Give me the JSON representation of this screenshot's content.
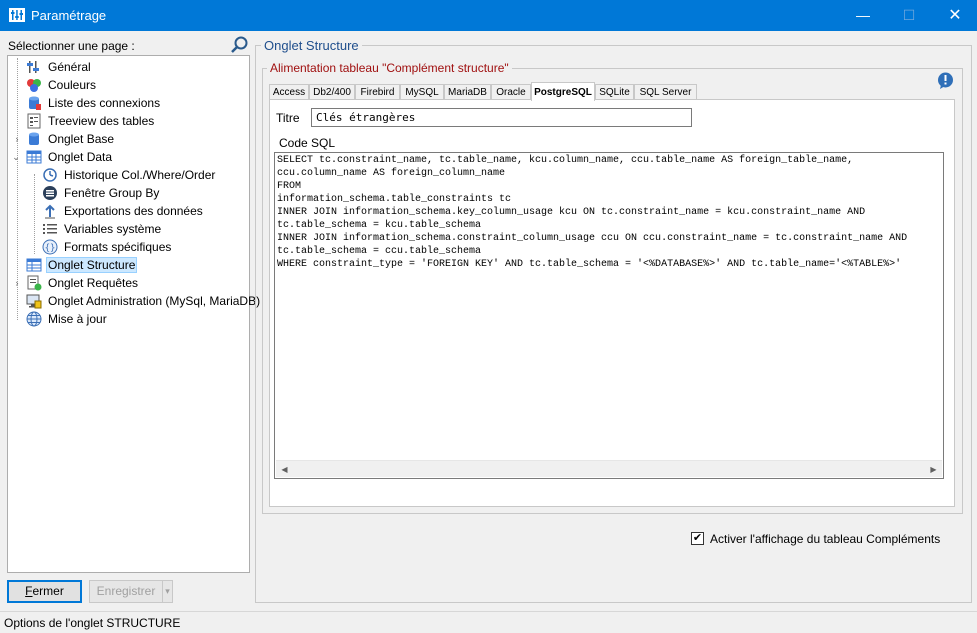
{
  "window": {
    "title": "Paramétrage",
    "min": "—",
    "max": "☐",
    "close": "✕"
  },
  "left": {
    "label": "Sélectionner une page :",
    "tree": [
      {
        "label": "Général"
      },
      {
        "label": "Couleurs"
      },
      {
        "label": "Liste des connexions"
      },
      {
        "label": "Treeview des tables"
      },
      {
        "label": "Onglet Base"
      },
      {
        "label": "Onglet Data"
      },
      {
        "label": "Historique Col./Where/Order"
      },
      {
        "label": "Fenêtre Group By"
      },
      {
        "label": "Exportations des données"
      },
      {
        "label": "Variables système"
      },
      {
        "label": "Formats spécifiques"
      },
      {
        "label": "Onglet Structure"
      },
      {
        "label": "Onglet Requêtes"
      },
      {
        "label": "Onglet Administration (MySql, MariaDB)"
      },
      {
        "label": "Mise à jour"
      }
    ],
    "buttons": {
      "close_first": "F",
      "close_rest": "ermer",
      "save": "Enregistrer",
      "save_dropdown": "▾"
    }
  },
  "right": {
    "group_title": "Onglet Structure",
    "subgroup_title": "Alimentation tableau \"Complément structure\"",
    "tabs": [
      "Access",
      "Db2/400",
      "Firebird",
      "MySQL",
      "MariaDB",
      "Oracle",
      "PostgreSQL",
      "SQLite",
      "SQL Server"
    ],
    "active_tab": "PostgreSQL",
    "titre_label": "Titre",
    "titre_value": "Clés étrangères",
    "code_label": "Code SQL",
    "code_sql": "SELECT tc.constraint_name, tc.table_name, kcu.column_name, ccu.table_name AS foreign_table_name,\nccu.column_name AS foreign_column_name\nFROM\ninformation_schema.table_constraints tc\nINNER JOIN information_schema.key_column_usage kcu ON tc.constraint_name = kcu.constraint_name AND\ntc.table_schema = kcu.table_schema\nINNER JOIN information_schema.constraint_column_usage ccu ON ccu.constraint_name = tc.constraint_name AND\ntc.table_schema = ccu.table_schema\nWHERE constraint_type = 'FOREIGN KEY' AND tc.table_schema = '<%DATABASE%>' AND tc.table_name='<%TABLE%>'",
    "checkbox_checked": true,
    "checkbox_mark": "✔",
    "checkbox_label": "Activer l'affichage du tableau Compléments"
  },
  "status": "Options de l'onglet STRUCTURE",
  "scroll": {
    "left": "◀",
    "right": "▶"
  },
  "colors": {
    "titlebar": "#0078d7",
    "selection": "#cce8ff",
    "group_title": "#1f4e8c",
    "subgroup_title": "#a01010"
  }
}
